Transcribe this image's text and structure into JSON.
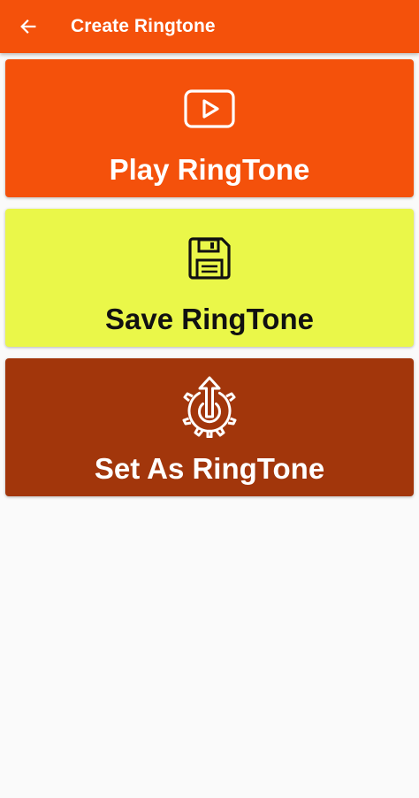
{
  "appbar": {
    "title": "Create Ringtone",
    "back_icon": "arrow-left-icon",
    "color": "#f4510b"
  },
  "actions": [
    {
      "label": "Play RingTone",
      "icon": "play-video-icon",
      "background": "#f4510b",
      "text_color": "#ffffff"
    },
    {
      "label": "Save RingTone",
      "icon": "floppy-disk-icon",
      "background": "#eaf749",
      "text_color": "#111111"
    },
    {
      "label": "Set As RingTone",
      "icon": "gear-upload-icon",
      "background": "#a2360b",
      "text_color": "#ffffff"
    }
  ]
}
